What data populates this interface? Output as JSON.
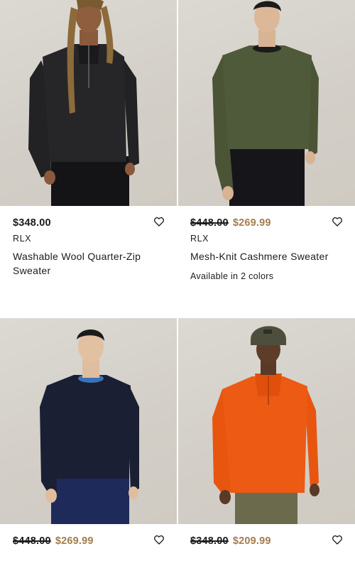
{
  "products": [
    {
      "price": "$348.00",
      "original_price": "",
      "sale_price": "",
      "brand": "RLX",
      "title": "Washable Wool Quarter-Zip Sweater",
      "colors": "",
      "sweater_color": "#1d1d1f",
      "image": "model-black-quarter-zip"
    },
    {
      "price": "",
      "original_price": "$448.00",
      "sale_price": "$269.99",
      "brand": "RLX",
      "title": "Mesh-Knit Cashmere Sweater",
      "colors": "Available in 2 colors",
      "sweater_color": "#4f5a3a",
      "image": "model-olive-crewneck"
    },
    {
      "price": "",
      "original_price": "$448.00",
      "sale_price": "$269.99",
      "brand": "",
      "title": "",
      "colors": "",
      "sweater_color": "#1a1f33",
      "image": "model-navy-crewneck"
    },
    {
      "price": "",
      "original_price": "$348.00",
      "sale_price": "$209.99",
      "brand": "",
      "title": "",
      "colors": "",
      "sweater_color": "#ec5a14",
      "image": "model-orange-quarter-zip"
    }
  ],
  "colors": {
    "sale": "#a37d4c",
    "text": "#1b1b1b",
    "background": "#ffffff"
  },
  "icons": {
    "wishlist": "heart-outline-icon"
  }
}
